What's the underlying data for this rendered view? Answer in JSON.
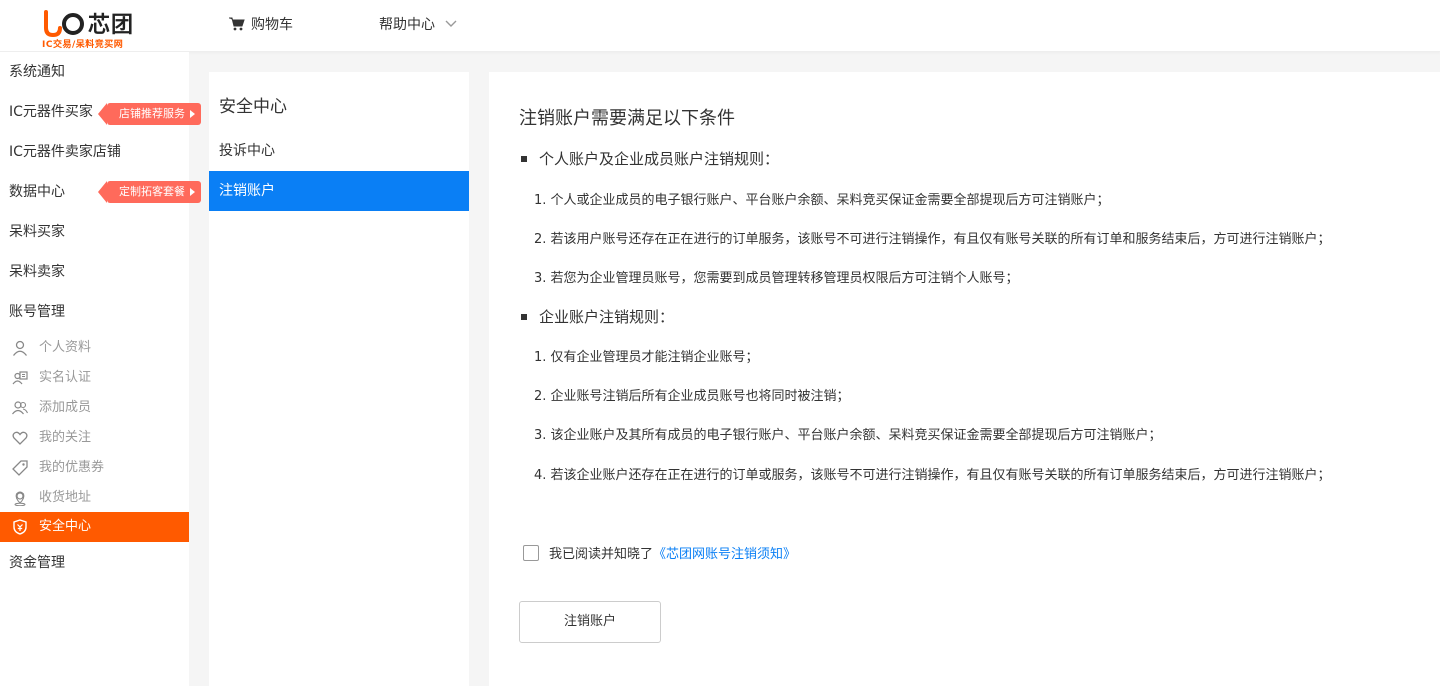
{
  "header": {
    "logo": {
      "text": "芯团",
      "subtitle": "IC交易/呆料竞买网"
    },
    "nav": {
      "cart": "购物车",
      "help": "帮助中心"
    }
  },
  "sidebar": {
    "items": [
      {
        "label": "系统通知"
      },
      {
        "label": "IC元器件买家",
        "promo": "店铺推荐服务"
      },
      {
        "label": "IC元器件卖家店铺"
      },
      {
        "label": "数据中心",
        "promo": "定制拓客套餐"
      },
      {
        "label": "呆料买家"
      },
      {
        "label": "呆料卖家"
      },
      {
        "label": "账号管理"
      }
    ],
    "account_sub": [
      {
        "label": "个人资料",
        "icon": "user-icon"
      },
      {
        "label": "实名认证",
        "icon": "id-card-icon"
      },
      {
        "label": "添加成员",
        "icon": "add-member-icon"
      },
      {
        "label": "我的关注",
        "icon": "heart-icon"
      },
      {
        "label": "我的优惠券",
        "icon": "coupon-icon"
      },
      {
        "label": "收货地址",
        "icon": "location-icon"
      },
      {
        "label": "安全中心",
        "icon": "shield-icon",
        "active": true
      }
    ],
    "after": {
      "label": "资金管理"
    }
  },
  "security_panel": {
    "title": "安全中心",
    "items": [
      {
        "label": "投诉中心"
      },
      {
        "label": "注销账户",
        "active": true
      }
    ]
  },
  "content": {
    "title": "注销账户需要满足以下条件",
    "personal": {
      "heading": "个人账户及企业成员账户注销规则：",
      "rules": [
        "1. 个人或企业成员的电子银行账户、平台账户余额、呆料竞买保证金需要全部提现后方可注销账户；",
        "2. 若该用户账号还存在正在进行的订单服务，该账号不可进行注销操作，有且仅有账号关联的所有订单和服务结束后，方可进行注销账户；",
        "3. 若您为企业管理员账号，您需要到成员管理转移管理员权限后方可注销个人账号；"
      ]
    },
    "enterprise": {
      "heading": "企业账户注销规则：",
      "rules": [
        "1. 仅有企业管理员才能注销企业账号；",
        "2. 企业账号注销后所有企业成员账号也将同时被注销；",
        "3. 该企业账户及其所有成员的电子银行账户、平台账户余额、呆料竞买保证金需要全部提现后方可注销账户；",
        "4. 若该企业账户还存在正在进行的订单或服务，该账号不可进行注销操作，有且仅有账号关联的所有订单服务结束后，方可进行注销账户；"
      ]
    },
    "agreement": {
      "text": "我已阅读并知晓了",
      "link": "《芯团网账号注销须知》",
      "checked": false
    },
    "button": "注销账户"
  },
  "colors": {
    "accent": "#ff5a00",
    "active_blue": "#0a7ff5",
    "promo": "#ff6a5b"
  }
}
